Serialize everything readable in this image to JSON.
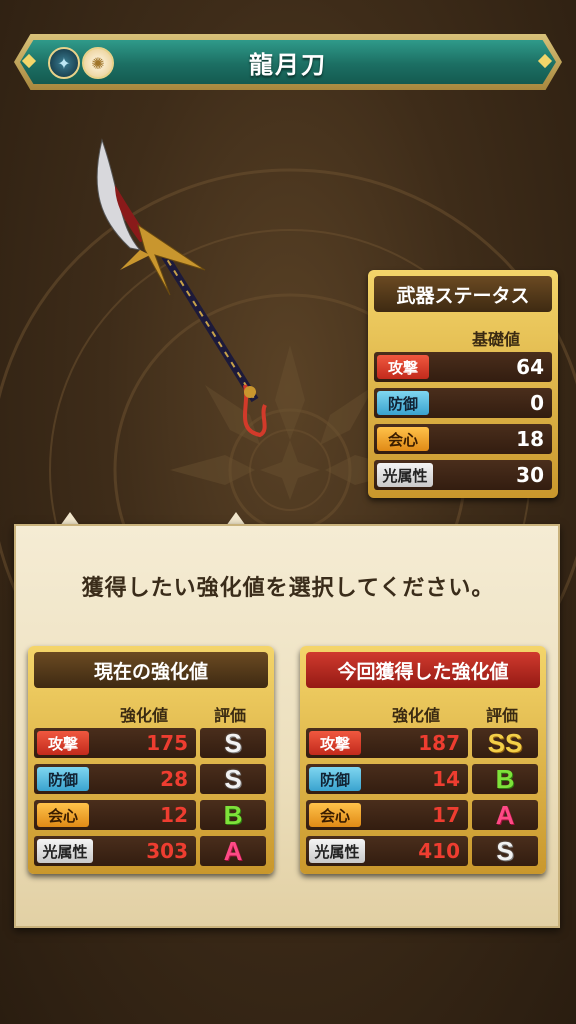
{
  "title": "龍月刀",
  "title_icons": [
    "dark-element-icon",
    "light-element-icon"
  ],
  "weapon_image": "spear-weapon",
  "weapon_status": {
    "header": "武器ステータス",
    "column": "基礎値",
    "rows": [
      {
        "label": "攻撃",
        "value": "64"
      },
      {
        "label": "防御",
        "value": "0"
      },
      {
        "label": "会心",
        "value": "18"
      },
      {
        "label": "光属性",
        "value": "30"
      }
    ]
  },
  "instruction": "獲得したい強化値を選択してください。",
  "current": {
    "header": "現在の強化値",
    "col_value": "強化値",
    "col_grade": "評価",
    "rows": [
      {
        "label": "攻撃",
        "value": "175",
        "grade": "S"
      },
      {
        "label": "防御",
        "value": "28",
        "grade": "S"
      },
      {
        "label": "会心",
        "value": "12",
        "grade": "B"
      },
      {
        "label": "光属性",
        "value": "303",
        "grade": "A"
      }
    ]
  },
  "new": {
    "header": "今回獲得した強化値",
    "col_value": "強化値",
    "col_grade": "評価",
    "rows": [
      {
        "label": "攻撃",
        "value": "187",
        "grade": "SS"
      },
      {
        "label": "防御",
        "value": "14",
        "grade": "B"
      },
      {
        "label": "会心",
        "value": "17",
        "grade": "A"
      },
      {
        "label": "光属性",
        "value": "410",
        "grade": "S"
      }
    ]
  },
  "colors": {
    "teal": "#1c6f63",
    "gold": "#c9972c",
    "red_value": "#ee3d30"
  }
}
